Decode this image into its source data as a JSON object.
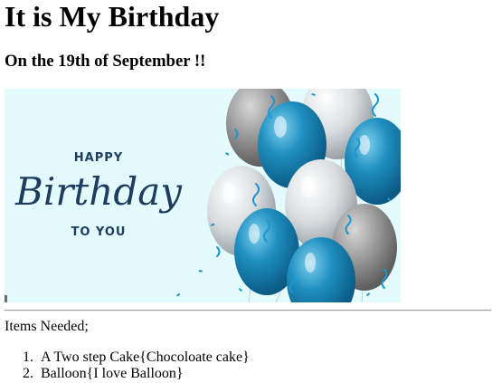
{
  "heading": "It is My Birthday",
  "subheading": "On the 19th of September !!",
  "banner": {
    "line1": "HAPPY",
    "line2": "Birthday",
    "line3": "TO YOU",
    "text_color": "#1d3c5e",
    "background": "#e4fbfd"
  },
  "items_intro": "Items Needed;",
  "items": [
    {
      "number": "1.",
      "text": "A Two step Cake{Chocoloate cake}"
    },
    {
      "number": "2.",
      "text": "Balloon{I love Balloon}"
    }
  ]
}
